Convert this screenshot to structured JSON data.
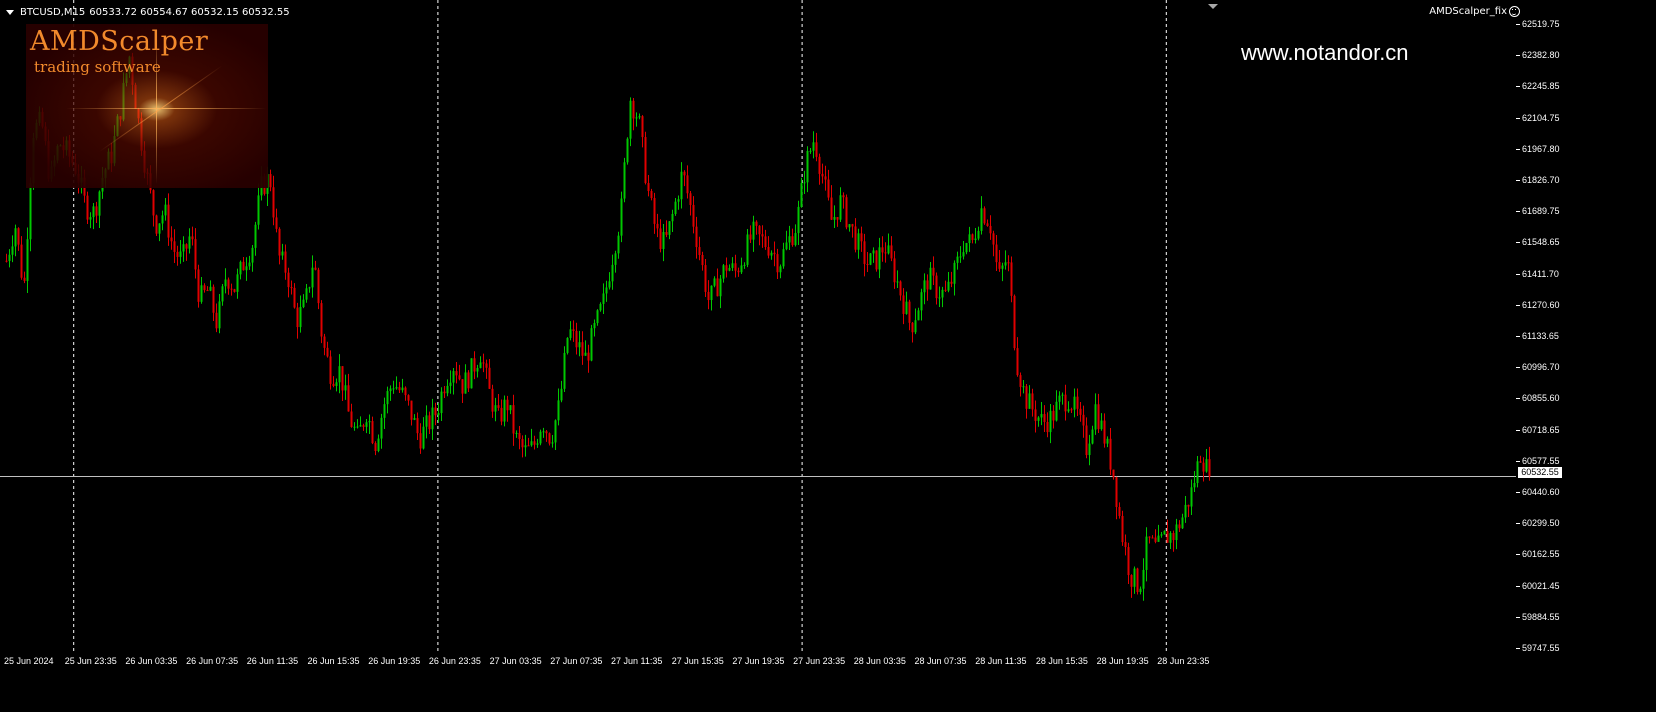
{
  "header": {
    "symbol": "BTCUSD,M15",
    "ohlc": "60533.72 60554.67 60532.15 60532.55",
    "indicator_name": "AMDScalper_fix"
  },
  "watermark": "www.notandor.cn",
  "logo": {
    "title": "AMDScalper",
    "subtitle": "trading software"
  },
  "colors": {
    "background": "#000000",
    "bull_candle": "#00c800",
    "bear_candle": "#e00000",
    "grid": "#ffffff",
    "current_price_line": "#c0c0c0"
  },
  "price_axis": {
    "current_price": "60532.55",
    "labels": [
      "62519.75",
      "62382.80",
      "62245.85",
      "62104.75",
      "61967.80",
      "61826.70",
      "61689.75",
      "61548.65",
      "61411.70",
      "61270.60",
      "61133.65",
      "60996.70",
      "60855.60",
      "60718.65",
      "60577.55",
      "60440.60",
      "60299.50",
      "60162.55",
      "60021.45",
      "59884.55",
      "59747.55"
    ]
  },
  "time_axis": {
    "labels": [
      "25 Jun 2024",
      "25 Jun 23:35",
      "26 Jun 03:35",
      "26 Jun 07:35",
      "26 Jun 11:35",
      "26 Jun 15:35",
      "26 Jun 19:35",
      "26 Jun 23:35",
      "27 Jun 03:35",
      "27 Jun 07:35",
      "27 Jun 11:35",
      "27 Jun 15:35",
      "27 Jun 19:35",
      "27 Jun 23:35",
      "28 Jun 03:35",
      "28 Jun 07:35",
      "28 Jun 11:35",
      "28 Jun 15:35",
      "28 Jun 19:35",
      "28 Jun 23:35"
    ]
  },
  "chart_data": {
    "type": "candlestick",
    "symbol": "BTCUSD",
    "timeframe": "M15",
    "ylim": [
      59700,
      62600
    ],
    "day_separators": [
      "25 Jun 23:35",
      "26 Jun 23:35",
      "27 Jun 23:35",
      "28 Jun 23:35"
    ],
    "current_price": 60532.55,
    "close_path": [
      61480,
      61640,
      61350,
      62050,
      62090,
      61830,
      62000,
      61950,
      61880,
      61720,
      61690,
      61860,
      61950,
      62150,
      62380,
      62100,
      61850,
      61640,
      61700,
      61530,
      61480,
      61600,
      61310,
      61350,
      61200,
      61420,
      61360,
      61470,
      61550,
      61800,
      61850,
      61500,
      61430,
      61220,
      61280,
      61500,
      61120,
      60980,
      61000,
      60800,
      60700,
      60820,
      60680,
      60850,
      60950,
      60900,
      60820,
      60700,
      60760,
      60820,
      60960,
      61030,
      60930,
      61000,
      61080,
      60900,
      60780,
      60860,
      60700,
      60640,
      60660,
      60780,
      60700,
      60850,
      61180,
      61110,
      61050,
      61180,
      61300,
      61500,
      61690,
      62200,
      62100,
      61800,
      61600,
      61550,
      61700,
      61870,
      61700,
      61500,
      61300,
      61380,
      61460,
      61430,
      61510,
      61600,
      61570,
      61540,
      61470,
      61560,
      61640,
      61900,
      62020,
      61840,
      61650,
      61740,
      61640,
      61550,
      61470,
      61480,
      61550,
      61440,
      61320,
      61190,
      61300,
      61410,
      61350,
      61330,
      61430,
      61560,
      61560,
      61710,
      61650,
      61400,
      61500,
      61050,
      60880,
      60820,
      60770,
      60790,
      60860,
      60880,
      60800,
      60660,
      60840,
      60710,
      60560,
      60290,
      60100,
      60050,
      60250,
      60210,
      60270,
      60280,
      60360,
      60470,
      60640,
      60532.55
    ]
  }
}
